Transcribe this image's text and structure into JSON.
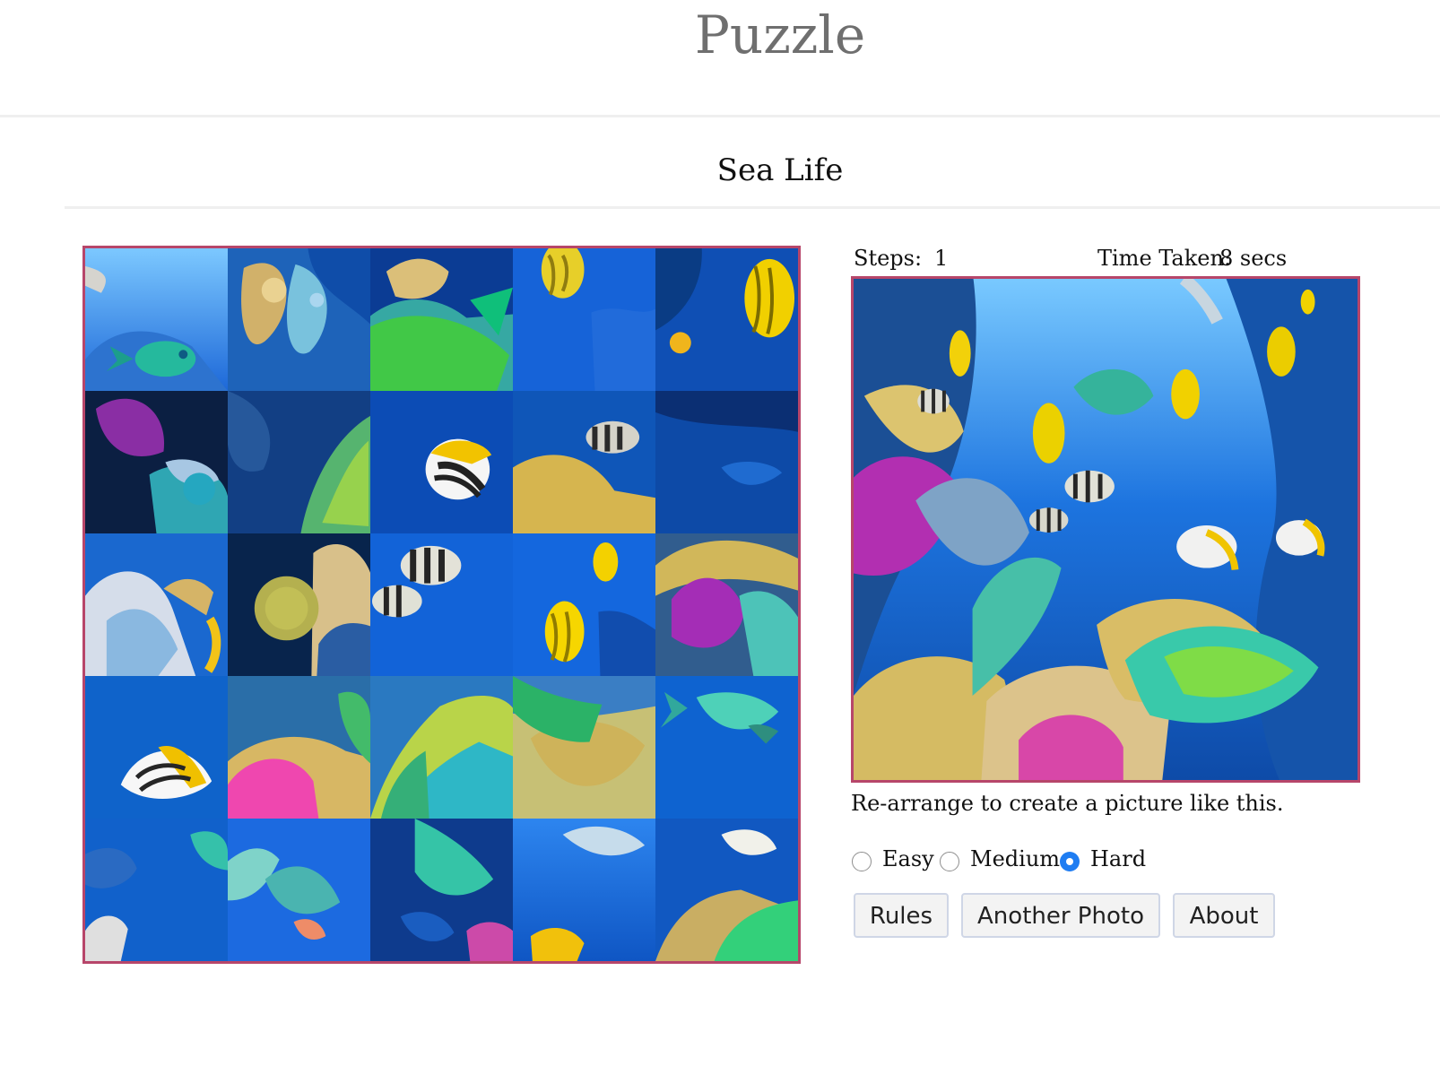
{
  "site": {
    "title": "Puzzle"
  },
  "puzzle": {
    "title": "Sea Life",
    "steps_label": "Steps:",
    "steps_value": "1",
    "time_label": "Time Taken:",
    "time_value": "8 secs",
    "hint": "Re-arrange to create a picture like this.",
    "difficulty": {
      "easy": "Easy",
      "medium": "Medium",
      "hard": "Hard",
      "selected": "Hard"
    },
    "buttons": {
      "rules": "Rules",
      "another_photo": "Another Photo",
      "about": "About"
    },
    "grid": {
      "rows": 5,
      "cols": 5,
      "total_tiles": 25
    },
    "colors": {
      "board_border": "#b7466a",
      "ocean": "#1a6fd8",
      "radio_selected": "#1f7df2",
      "button_border": "#cfd6e6"
    }
  }
}
